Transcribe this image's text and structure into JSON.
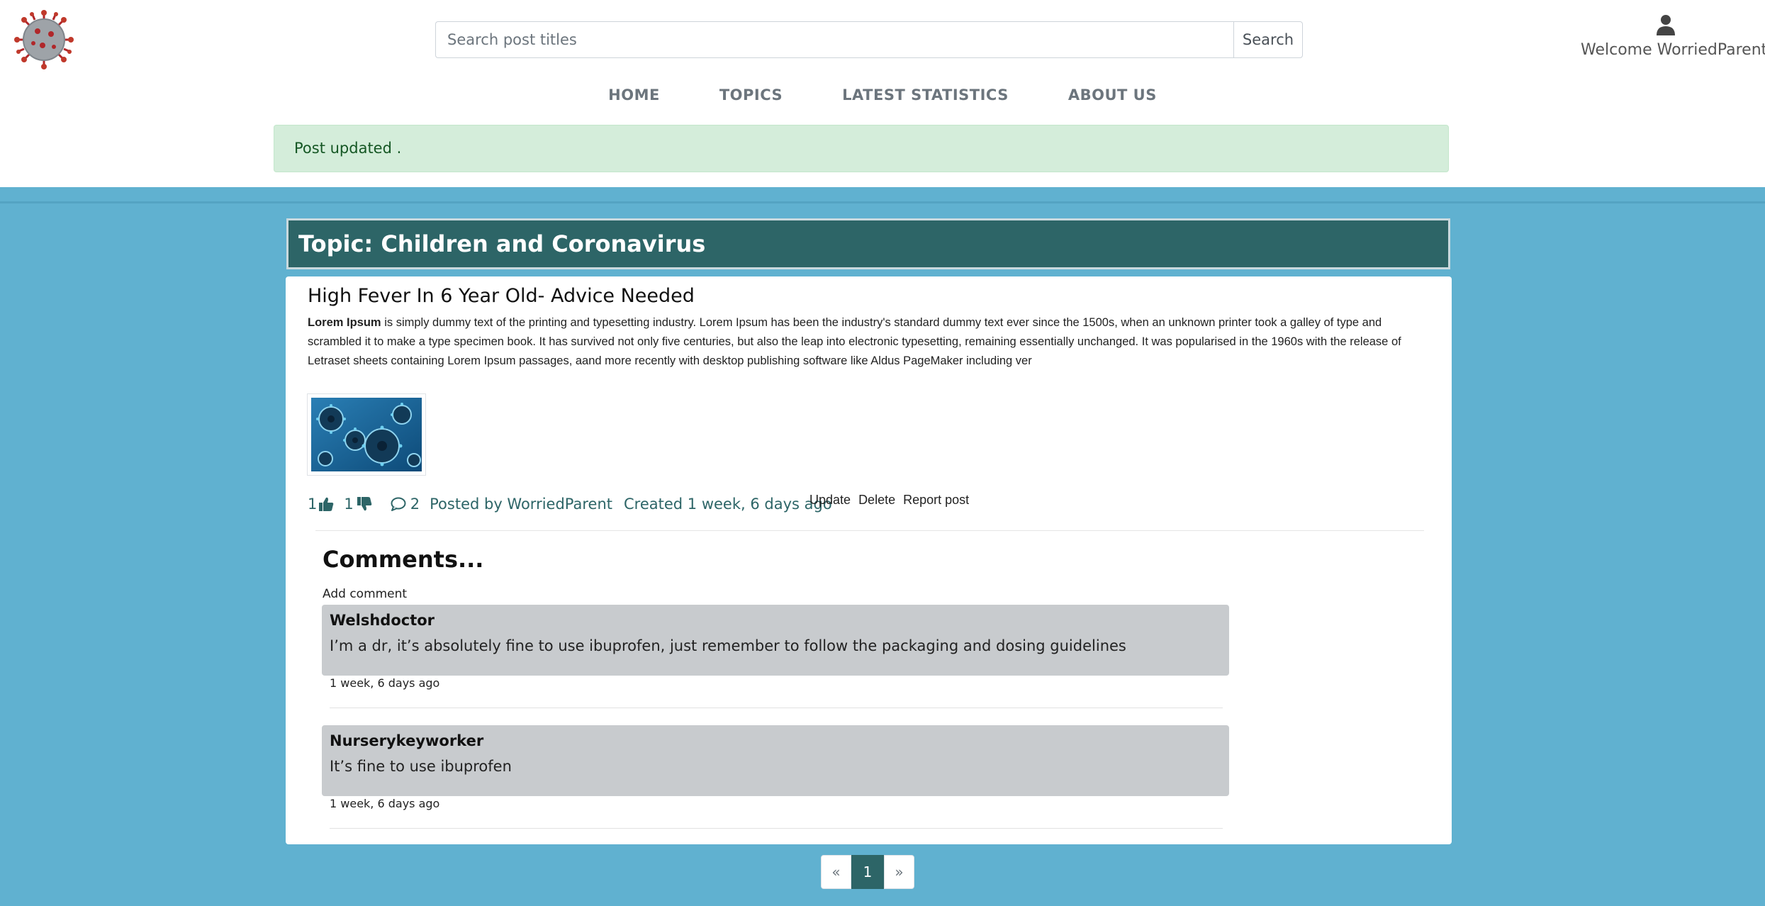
{
  "header": {
    "logo_icon": "coronavirus-logo-icon",
    "search": {
      "placeholder": "Search post titles",
      "button_label": "Search"
    },
    "user": {
      "icon": "user-icon",
      "welcome_text": "Welcome WorriedParent"
    }
  },
  "nav": {
    "items": [
      {
        "label": "HOME"
      },
      {
        "label": "TOPICS"
      },
      {
        "label": "LATEST STATISTICS"
      },
      {
        "label": "ABOUT US"
      }
    ]
  },
  "alert": {
    "message": "Post updated ."
  },
  "topic": {
    "title": "Topic: Children and Coronavirus"
  },
  "post": {
    "title": "High Fever In 6 Year Old- Advice Needed",
    "body_bold": "Lorem Ipsum",
    "body_text": " is simply dummy text of the printing and typesetting industry. Lorem Ipsum has been the industry's standard dummy text ever since the 1500s, when an unknown printer took a galley of type and scrambled it to make a type specimen book. It has survived not only five centuries, but also the leap into electronic typesetting, remaining essentially unchanged. It was popularised in the 1960s with the release of Letraset sheets containing Lorem Ipsum passages, aand more recently with desktop publishing software like Aldus PageMaker including ver",
    "image": "virus-thumbnail-image",
    "likes": "1",
    "dislikes": "1",
    "comment_count": "2",
    "posted_by": "Posted by WorriedParent",
    "created": "Created 1 week, 6 days ago",
    "actions": {
      "update": "Update",
      "delete": "Delete",
      "report": "Report post"
    }
  },
  "comments": {
    "heading": "Comments...",
    "add_label": "Add comment",
    "items": [
      {
        "author": "Welshdoctor",
        "text": "I’m a dr, it’s absolutely fine to use ibuprofen, just remember to follow the packaging and dosing guidelines",
        "date": "1 week, 6 days ago"
      },
      {
        "author": "Nurserykeyworker",
        "text": "It’s fine to use ibuprofen",
        "date": "1 week, 6 days ago"
      }
    ]
  },
  "pagination": {
    "prev": "«",
    "current": "1",
    "next": "»"
  },
  "colors": {
    "page_bg": "#60b1d0",
    "topic_bg": "#2d6567",
    "alert_bg": "#d4edda",
    "comment_bg": "#c8cbce"
  }
}
